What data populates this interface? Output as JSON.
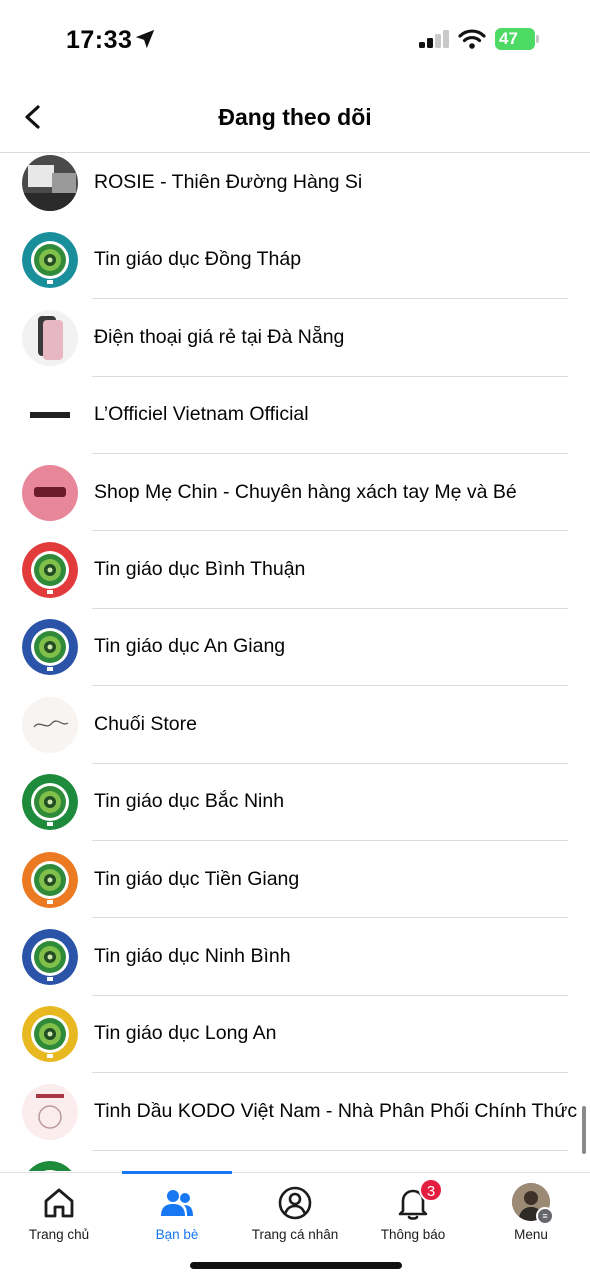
{
  "status_bar": {
    "time": "17:33",
    "battery_text": "47"
  },
  "header": {
    "title": "Đang theo dõi"
  },
  "list": {
    "items": [
      {
        "name": "ROSIE - Thiên Đường Hàng Si",
        "avatar": "rosie-store-photo",
        "ring": "#3a3a3a"
      },
      {
        "name": "Tin giáo dục Đồng Tháp",
        "avatar": "education-logo",
        "ring": "#1a8f9c"
      },
      {
        "name": "Điện thoại giá rẻ tại Đà Nẵng",
        "avatar": "phone-photo",
        "ring": "#d9d9d9"
      },
      {
        "name": "L’Officiel Vietnam Official",
        "avatar": "lofficiel-logo",
        "ring": "#e6e6e6"
      },
      {
        "name": "Shop Mẹ Chin - Chuyên hàng xách tay Mẹ và Bé",
        "avatar": "me-chin-logo",
        "ring": "#e8879a"
      },
      {
        "name": "Tin giáo dục Bình Thuận",
        "avatar": "education-logo",
        "ring": "#e23b3b"
      },
      {
        "name": "Tin giáo dục An Giang",
        "avatar": "education-logo",
        "ring": "#2b54a8"
      },
      {
        "name": "Chuối Store",
        "avatar": "chuoi-store-logo",
        "ring": "#eeeeee"
      },
      {
        "name": "Tin giáo dục Bắc Ninh",
        "avatar": "education-logo",
        "ring": "#1e8a3c"
      },
      {
        "name": "Tin giáo dục Tiền Giang",
        "avatar": "education-logo",
        "ring": "#ec7a22"
      },
      {
        "name": "Tin giáo dục Ninh Bình",
        "avatar": "education-logo",
        "ring": "#2b54a8"
      },
      {
        "name": "Tin giáo dục Long An",
        "avatar": "education-logo",
        "ring": "#e8b820"
      },
      {
        "name": "Tinh Dầu KODO Việt Nam - Nhà Phân Phối Chính Thức",
        "avatar": "kodo-logo",
        "ring": "#f2d6da"
      },
      {
        "name": "",
        "avatar": "education-logo",
        "ring": "#1e8a3c"
      }
    ]
  },
  "tab_bar": {
    "tabs": [
      {
        "label": "Trang chủ",
        "icon": "home-icon"
      },
      {
        "label": "Bạn bè",
        "icon": "friends-icon",
        "active": true
      },
      {
        "label": "Trang cá nhân",
        "icon": "profile-icon"
      },
      {
        "label": "Thông báo",
        "icon": "bell-icon",
        "badge": "3"
      },
      {
        "label": "Menu",
        "icon": "menu-avatar"
      }
    ]
  },
  "colors": {
    "accent": "#1877f2",
    "badge": "#e41e3f",
    "battery": "#4cd964"
  }
}
